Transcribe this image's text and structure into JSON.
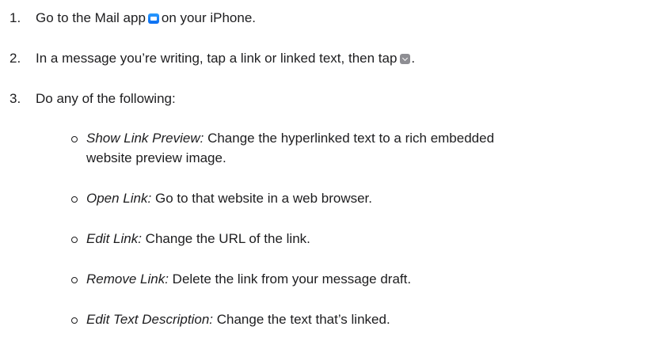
{
  "steps": [
    {
      "number": "1.",
      "before": "Go to the Mail app",
      "icon": "mail-app-icon",
      "after": "on your iPhone."
    },
    {
      "number": "2.",
      "before": "In a message you’re writing, tap a link or linked text, then tap",
      "icon": "chevron-down-icon",
      "after": "."
    },
    {
      "number": "3.",
      "text": "Do any of the following:"
    }
  ],
  "options": [
    {
      "term": "Show Link Preview:",
      "desc": "Change the hyperlinked text to a rich embedded",
      "desc2": "website preview image."
    },
    {
      "term": "Open Link:",
      "desc": "Go to that website in a web browser."
    },
    {
      "term": "Edit Link:",
      "desc": "Change the URL of the link."
    },
    {
      "term": "Remove Link:",
      "desc": "Delete the link from your message draft."
    },
    {
      "term": "Edit Text Description:",
      "desc": "Change the text that’s linked."
    }
  ],
  "colors": {
    "text": "#1d1d1f",
    "mail_icon": "#1a84ff",
    "chevron_icon": "#8e8e93"
  }
}
